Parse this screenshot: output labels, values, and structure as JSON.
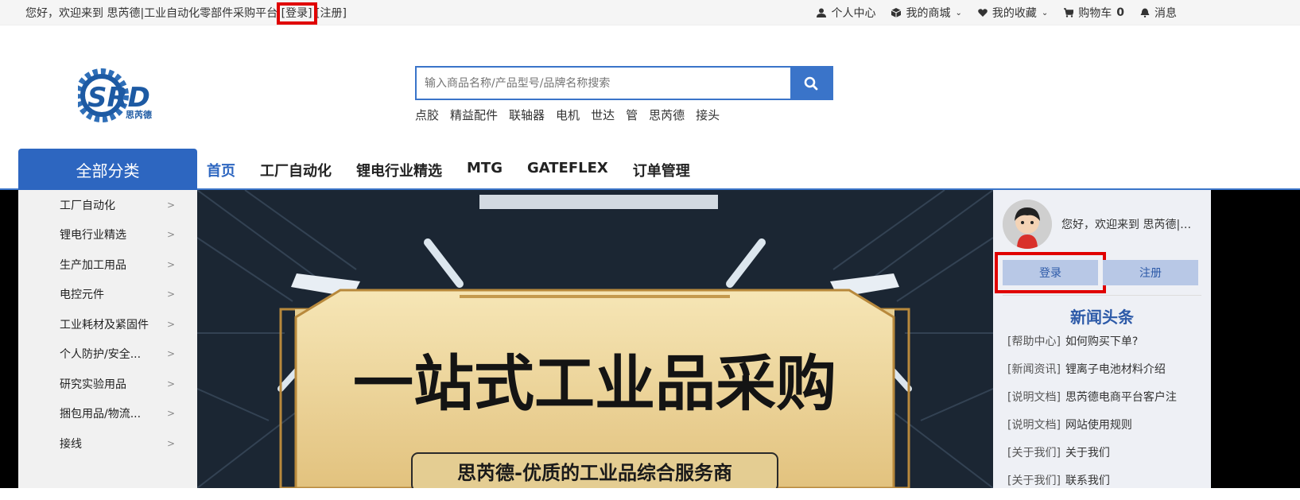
{
  "topbar": {
    "welcome_prefix": "您好，欢迎来到 思芮德|工业自动化零部件采购平台 ",
    "login_link": "[登录]",
    "register_link": " [注册]",
    "personal_center": "个人中心",
    "my_mall": "我的商城",
    "my_favorites": "我的收藏",
    "cart_label": "购物车",
    "cart_count": "0",
    "messages": "消息"
  },
  "logo": {
    "text": "SRD",
    "subtitle": "思芮德"
  },
  "search": {
    "placeholder": "输入商品名称/产品型号/品牌名称搜索",
    "hotwords": [
      "点胶",
      "精益配件",
      "联轴器",
      "电机",
      "世达",
      "管",
      "思芮德",
      "接头"
    ]
  },
  "nav": {
    "all_categories": "全部分类",
    "items": [
      "首页",
      "工厂自动化",
      "锂电行业精选",
      "MTG",
      "GATEFLEX",
      "订单管理"
    ]
  },
  "categories": [
    "工厂自动化",
    "锂电行业精选",
    "生产加工用品",
    "电控元件",
    "工业耗材及紧固件",
    "个人防护/安全...",
    "研究实验用品",
    "捆包用品/物流...",
    "接线"
  ],
  "banner": {
    "headline": "一站式工业品采购",
    "tagline": "思芮德-优质的工业品综合服务商"
  },
  "side_panel": {
    "welcome": "您好，欢迎来到 思芮德|工业自动化零部件采购平台",
    "login_button": "登录",
    "register_button": "注册",
    "news_title": "新闻头条",
    "news": [
      {
        "tag": "[帮助中心]",
        "text": "如何购买下单?"
      },
      {
        "tag": "[新闻资讯]",
        "text": "锂离子电池材料介绍"
      },
      {
        "tag": "[说明文档]",
        "text": "思芮德电商平台客户注"
      },
      {
        "tag": "[说明文档]",
        "text": "网站使用规则"
      },
      {
        "tag": "[关于我们]",
        "text": "关于我们"
      },
      {
        "tag": "[关于我们]",
        "text": "联系我们"
      }
    ]
  },
  "colors": {
    "accent": "#2d66c0",
    "highlight": "#e00000"
  }
}
